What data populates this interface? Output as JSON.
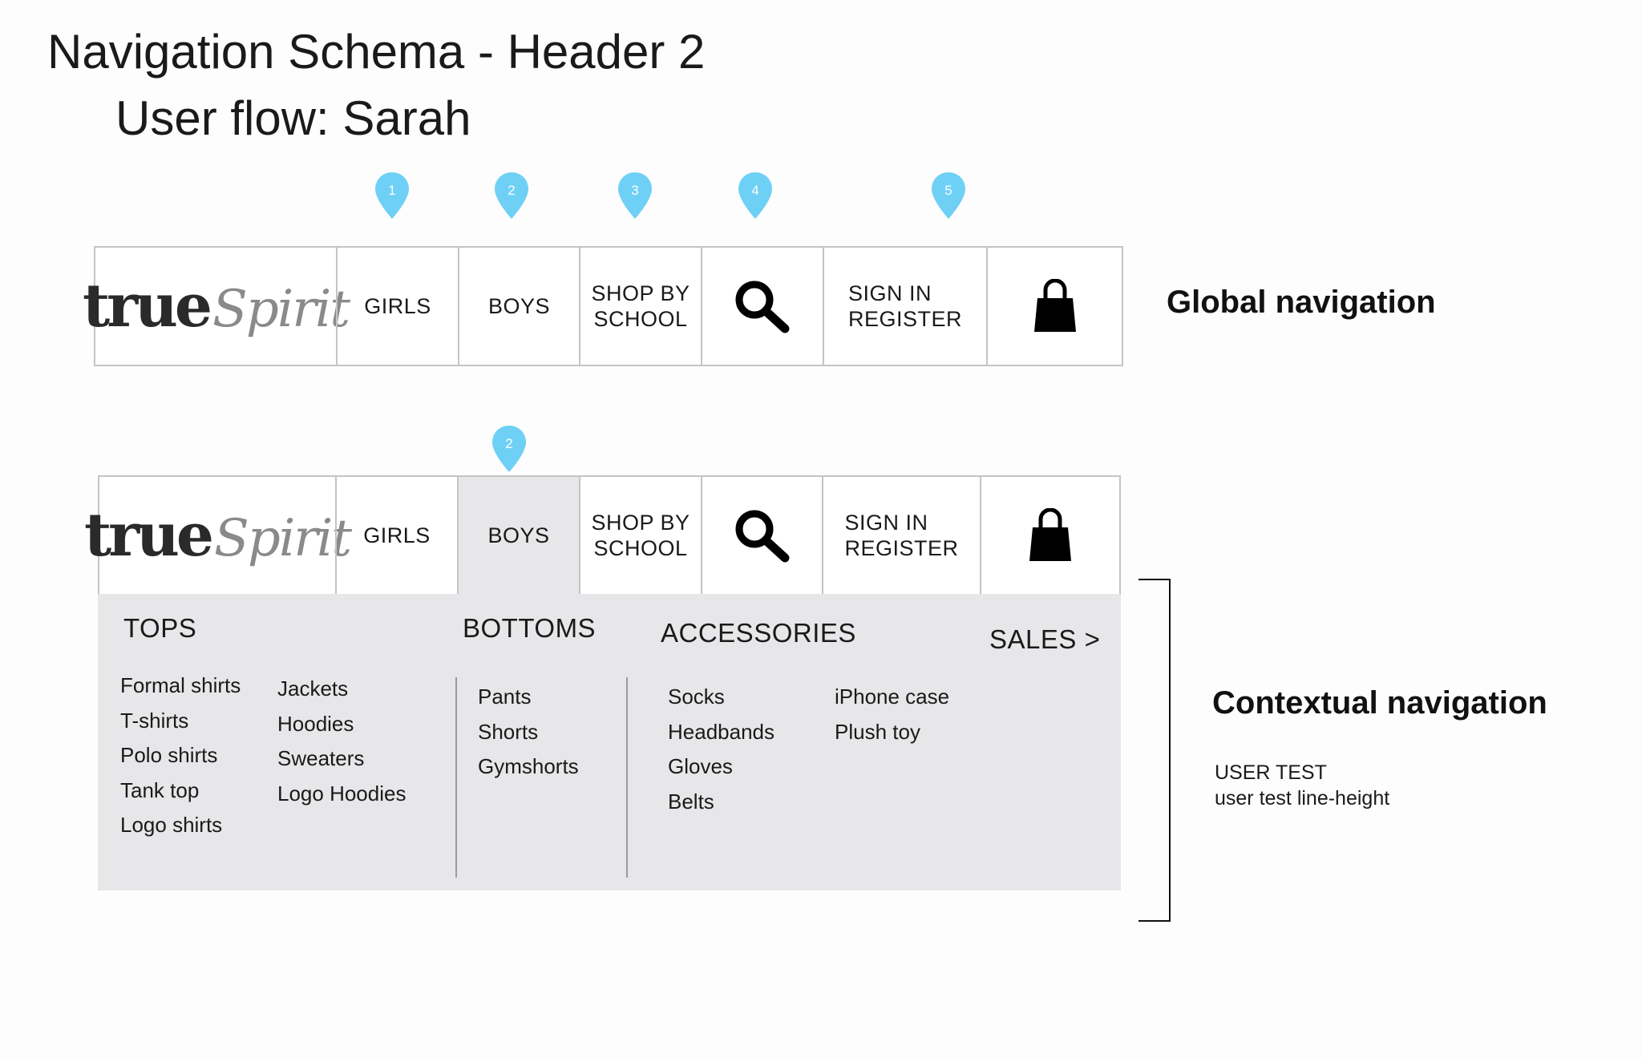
{
  "title": "Navigation Schema - Header 2",
  "subtitle": "User flow: Sarah",
  "colors": {
    "pin": "#6fd0f6",
    "active_cell": "#e7e6e8",
    "dropdown_bg": "#e7e6e8",
    "border": "#c4c4c4"
  },
  "logo": {
    "part1": "true",
    "part2": "Spirit"
  },
  "global_nav": {
    "girls": "GIRLS",
    "boys": "BOYS",
    "shop_line1": "SHOP BY",
    "shop_line2": "SCHOOL",
    "search_icon": "search-icon",
    "signin_line1": "SIGN IN",
    "signin_line2": "REGISTER",
    "bag_icon": "shopping-bag-icon",
    "pins": [
      "1",
      "2",
      "3",
      "4",
      "5"
    ],
    "label": "Global navigation"
  },
  "contextual_nav": {
    "girls": "GIRLS",
    "boys": "BOYS",
    "shop_line1": "SHOP BY",
    "shop_line2": "SCHOOL",
    "signin_line1": "SIGN IN",
    "signin_line2": "REGISTER",
    "pin": "2",
    "label": "Contextual navigation",
    "note_line1": "USER TEST",
    "note_line2": "user test line-height"
  },
  "dropdown": {
    "tops_heading": "TOPS",
    "tops_col1": [
      "Formal shirts",
      "T-shirts",
      "Polo shirts",
      "Tank top",
      "Logo shirts"
    ],
    "tops_col2": [
      "Jackets",
      "Hoodies",
      "Sweaters",
      "Logo Hoodies"
    ],
    "bottoms_heading": "BOTTOMS",
    "bottoms": [
      "Pants",
      "Shorts",
      "Gymshorts"
    ],
    "accessories_heading": "ACCESSORIES",
    "accessories_col1": [
      "Socks",
      "Headbands",
      "Gloves",
      "Belts"
    ],
    "accessories_col2": [
      "iPhone case",
      "Plush toy"
    ],
    "sales": "SALES >"
  }
}
